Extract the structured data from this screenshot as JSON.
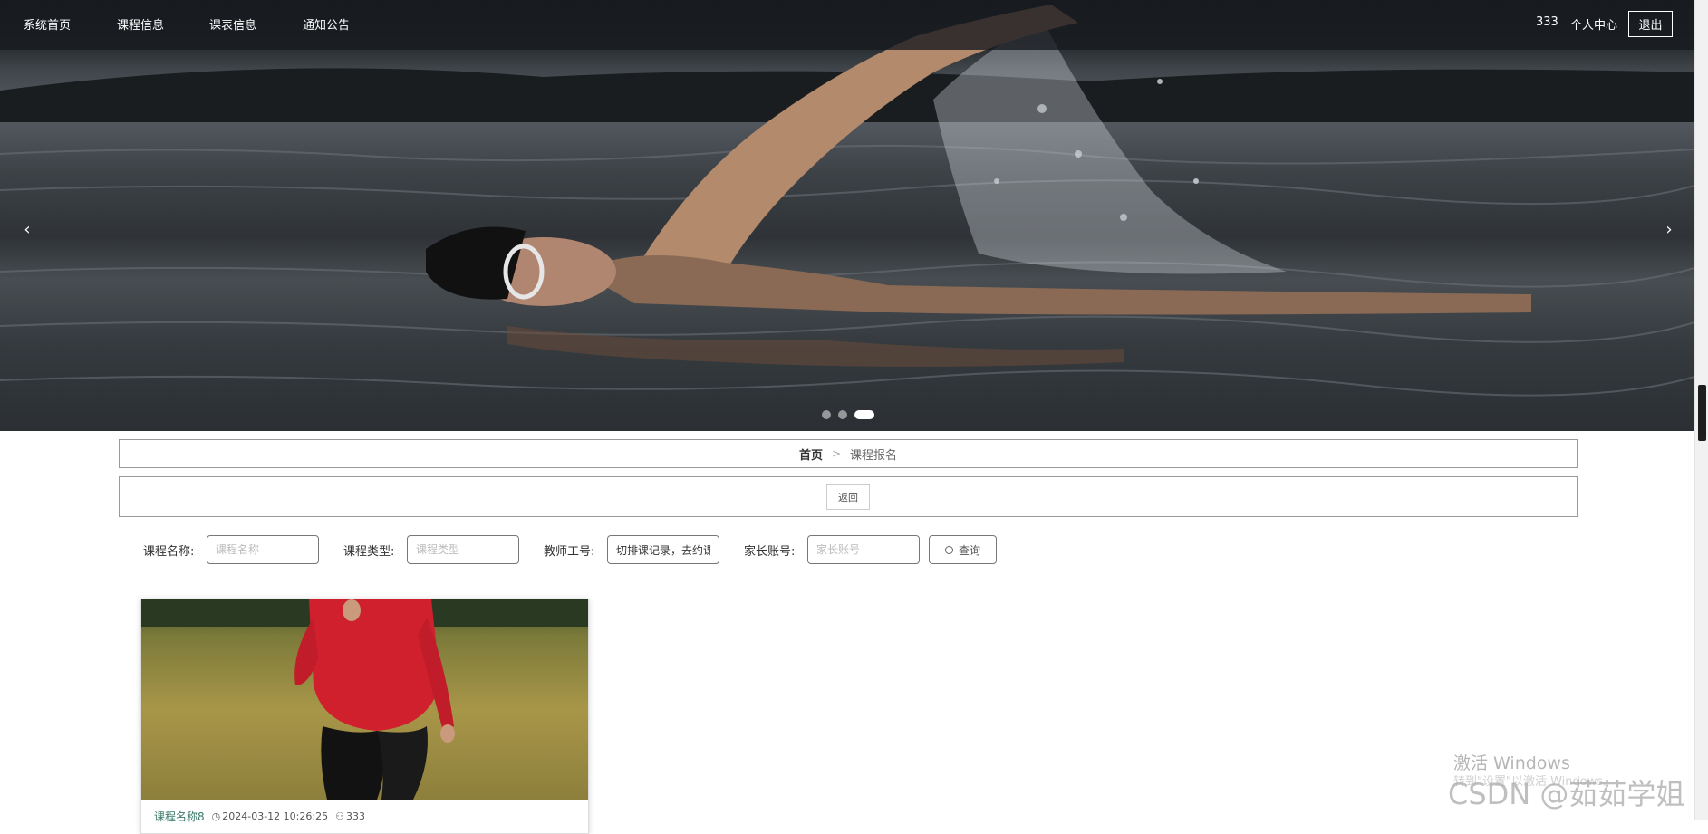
{
  "nav": {
    "items": [
      {
        "label": "系统首页"
      },
      {
        "label": "课程信息"
      },
      {
        "label": "课表信息"
      },
      {
        "label": "通知公告"
      }
    ],
    "username": "333",
    "profile_label": "个人中心",
    "logout_label": "退出"
  },
  "carousel": {
    "prev_icon": "‹",
    "next_icon": "›",
    "slide_count": 3,
    "active_index": 3
  },
  "breadcrumb": {
    "home": "首页",
    "separator": ">",
    "current": "课程报名"
  },
  "back_label": "返回",
  "search": {
    "fields": [
      {
        "label": "课程名称:",
        "placeholder": "课程名称",
        "value": ""
      },
      {
        "label": "课程类型:",
        "placeholder": "课程类型",
        "value": ""
      },
      {
        "label": "教师工号:",
        "placeholder": "",
        "value": "切排课记录，去约课"
      },
      {
        "label": "家长账号:",
        "placeholder": "家长账号",
        "value": ""
      }
    ],
    "button_label": "查询",
    "button_icon": "search-icon"
  },
  "courses": [
    {
      "title": "课程名称8",
      "time": "2024-03-12 10:26:25",
      "time_icon": "clock-icon",
      "user": "333",
      "user_icon": "user-icon"
    }
  ],
  "watermarks": {
    "windows_title": "激活 Windows",
    "windows_sub": "转到\"设置\"以激活 Windows。",
    "csdn": "CSDN @茹茹学姐"
  },
  "colors": {
    "nav_bg": "#16181e",
    "accent_text": "#3a7a6a"
  }
}
